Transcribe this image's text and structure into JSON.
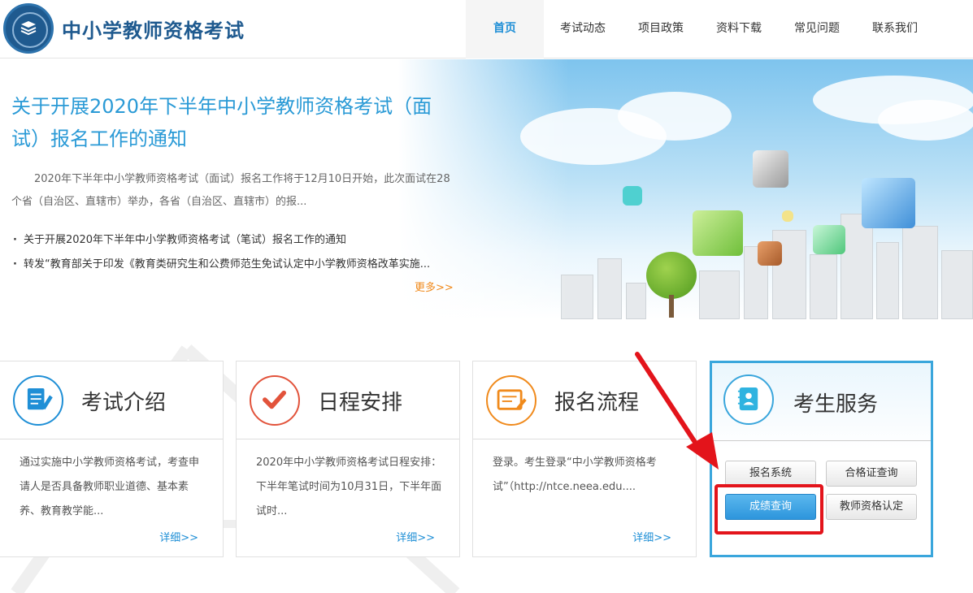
{
  "brand": {
    "title": "中小学教师资格考试"
  },
  "nav": {
    "items": [
      {
        "label": "首页",
        "active": true
      },
      {
        "label": "考试动态",
        "active": false
      },
      {
        "label": "项目政策",
        "active": false
      },
      {
        "label": "资料下载",
        "active": false
      },
      {
        "label": "常见问题",
        "active": false
      },
      {
        "label": "联系我们",
        "active": false
      }
    ]
  },
  "banner": {
    "title": "关于开展2020年下半年中小学教师资格考试（面试）报名工作的通知",
    "description": "2020年下半年中小学教师资格考试（面试）报名工作将于12月10日开始，此次面试在28个省（自治区、直辖市）举办，各省（自治区、直辖市）的报...",
    "news": [
      "关于开展2020年下半年中小学教师资格考试（笔试）报名工作的通知",
      "转发“教育部关于印发《教育类研究生和公费师范生免试认定中小学教师资格改革实施..."
    ],
    "more": "更多>>"
  },
  "cards": [
    {
      "title": "考试介绍",
      "icon": "document-icon",
      "body": "通过实施中小学教师资格考试，考查申请人是否具备教师职业道德、基本素养、教育教学能...",
      "more": "详细>>",
      "color": "#1f8fd6"
    },
    {
      "title": "日程安排",
      "icon": "checkmark-icon",
      "body": "2020年中小学教师资格考试日程安排：下半年笔试时间为10月31日，下半年面试时...",
      "more": "详细>>",
      "color": "#e2533b"
    },
    {
      "title": "报名流程",
      "icon": "form-icon",
      "body": "登录。考生登录“中小学教师资格考试”（http://ntce.neea.edu....",
      "more": "详细>>",
      "color": "#f08a1c"
    }
  ],
  "service": {
    "title": "考生服务",
    "icon": "student-book-icon",
    "buttons": {
      "register": "报名系统",
      "certificate": "合格证查询",
      "score": "成绩查询",
      "qualification": "教师资格认定"
    }
  },
  "colors": {
    "brand": "#1f5a8f",
    "accent": "#1f8fd6",
    "highlight": "#e3141b",
    "more": "#f08a1c"
  }
}
